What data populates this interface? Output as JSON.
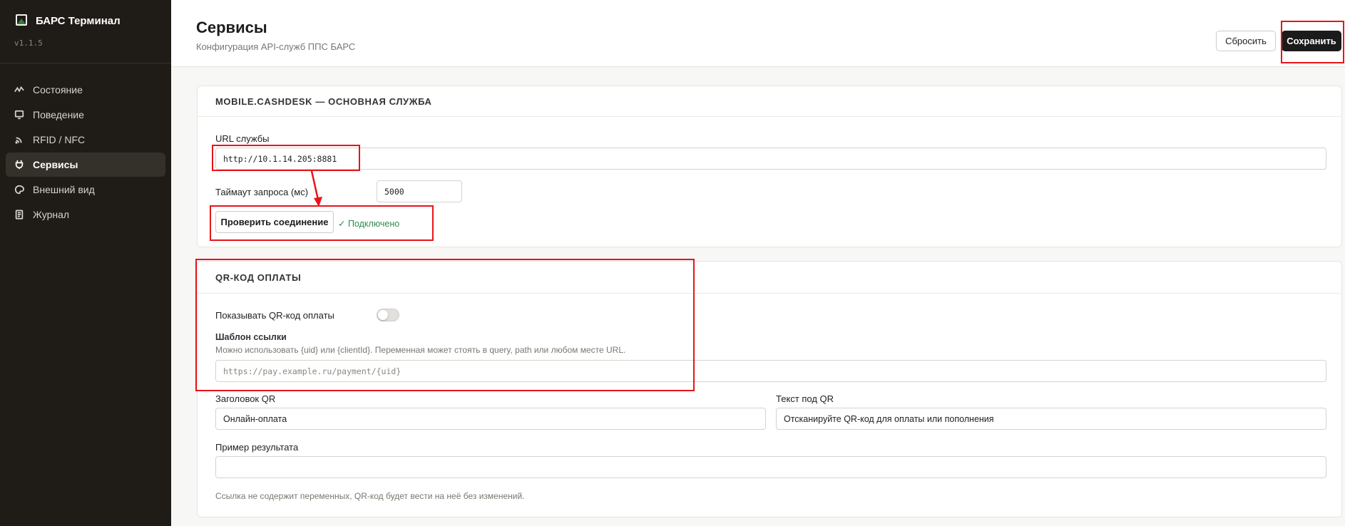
{
  "sidebar": {
    "app_title": "БАРС Терминал",
    "version": "v1.1.5",
    "items": [
      {
        "label": "Состояние",
        "icon": "activity-icon"
      },
      {
        "label": "Поведение",
        "icon": "monitor-icon"
      },
      {
        "label": "RFID / NFC",
        "icon": "rfid-icon"
      },
      {
        "label": "Сервисы",
        "icon": "plug-icon",
        "active": true
      },
      {
        "label": "Внешний вид",
        "icon": "palette-icon"
      },
      {
        "label": "Журнал",
        "icon": "log-icon"
      }
    ]
  },
  "header": {
    "title": "Сервисы",
    "subtitle": "Конфигурация API-служб ППС БАРС",
    "reset_label": "Сбросить",
    "save_label": "Сохранить"
  },
  "cashdesk": {
    "title": "MOBILE.CASHDESK — ОСНОВНАЯ СЛУЖБА",
    "url_label": "URL службы",
    "url_value": "http://10.1.14.205:8881",
    "timeout_label": "Таймаут запроса (мс)",
    "timeout_value": "5000",
    "check_label": "Проверить соединение",
    "status_text": "✓ Подключено"
  },
  "qr": {
    "title": "QR-КОД ОПЛАТЫ",
    "show_label": "Показывать QR-код оплаты",
    "show_enabled": false,
    "template_label": "Шаблон ссылки",
    "template_hint": "Можно использовать {uid} или {clientId}. Переменная может стоять в query, path или любом месте URL.",
    "template_placeholder": "https://pay.example.ru/payment/{uid}",
    "heading_label": "Заголовок QR",
    "heading_value": "Онлайн-оплата",
    "caption_label": "Текст под QR",
    "caption_value": "Отсканируйте QR-код для оплаты или пополнения",
    "example_label": "Пример результата",
    "example_value": "",
    "footer_note": "Ссылка не содержит переменных, QR-код будет вести на неё без изменений."
  },
  "colors": {
    "sidebar_bg": "#1f1c18",
    "accent": "#1b1b1b",
    "success": "#2f8a4b",
    "annotation": "#e8141a"
  }
}
